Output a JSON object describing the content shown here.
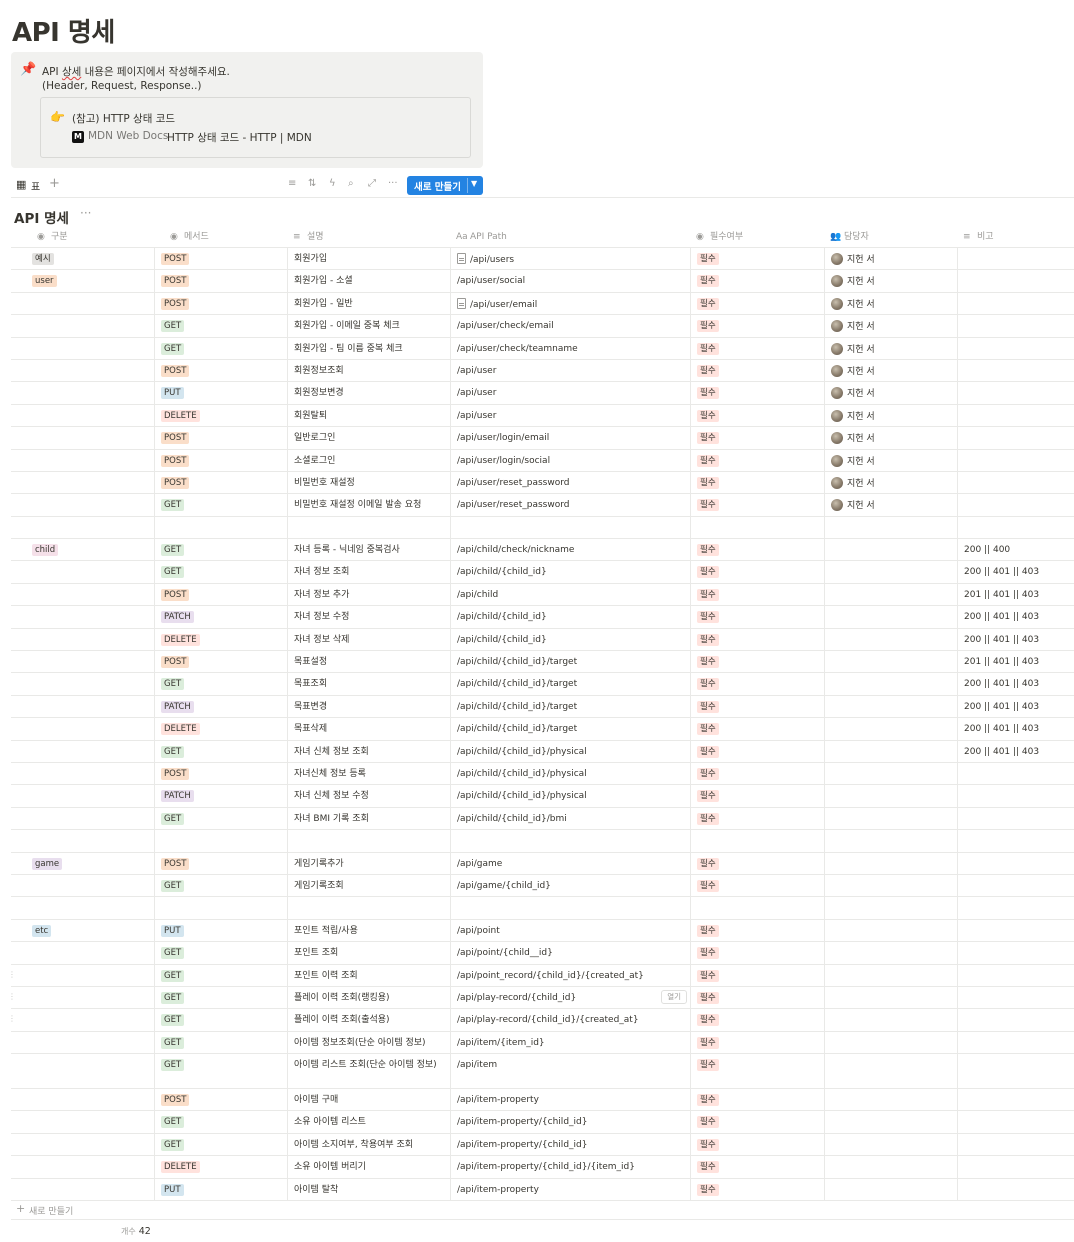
{
  "page": {
    "title": "API 명세"
  },
  "callout": {
    "icon": "pushpin-icon",
    "line1_pre": "API ",
    "line1_squiggle": "상세",
    "line1_post": " 내용은 페이지에서 작성해주세요.",
    "line2": "(Header, Request, Response..)",
    "ref_title": "(참고) HTTP 상태 코드",
    "ref_logo": "M",
    "ref_source": "MDN Web Docs",
    "ref_link": "HTTP 상태 코드 - HTTP | MDN"
  },
  "toolbar": {
    "view_label": "표",
    "add": "+",
    "new_label": "새로 만들기"
  },
  "database": {
    "title": "API 명세",
    "more": "···",
    "columns": {
      "group": "구분",
      "method": "메서드",
      "desc": "설명",
      "path": "API Path",
      "required": "필수여부",
      "owner": "담당자",
      "note": "비고"
    },
    "rows": [
      {
        "group": "예시",
        "method": "POST",
        "desc": "회원가입",
        "path": "/api/users",
        "doc": true,
        "req": "필수",
        "owner": "지헌 서",
        "note": ""
      },
      {
        "group": "user",
        "method": "POST",
        "desc": "회원가입 - 소셜",
        "path": "/api/user/social",
        "req": "필수",
        "owner": "지헌 서",
        "note": ""
      },
      {
        "group": "",
        "method": "POST",
        "desc": "회원가입 - 일반",
        "path": "/api/user/email",
        "doc": true,
        "req": "필수",
        "owner": "지헌 서",
        "note": ""
      },
      {
        "group": "",
        "method": "GET",
        "desc": "회원가입 - 이메일 중복 체크",
        "path": "/api/user/check/email",
        "req": "필수",
        "owner": "지헌 서",
        "note": ""
      },
      {
        "group": "",
        "method": "GET",
        "desc": "회원가입 - 팀 이름 중복 체크",
        "path": "/api/user/check/teamname",
        "req": "필수",
        "owner": "지헌 서",
        "note": ""
      },
      {
        "group": "",
        "method": "POST",
        "desc": "회원정보조회",
        "path": "/api/user",
        "req": "필수",
        "owner": "지헌 서",
        "note": ""
      },
      {
        "group": "",
        "method": "PUT",
        "desc": "회원정보변경",
        "path": "/api/user",
        "req": "필수",
        "owner": "지헌 서",
        "note": ""
      },
      {
        "group": "",
        "method": "DELETE",
        "desc": "회원탈퇴",
        "path": "/api/user",
        "req": "필수",
        "owner": "지헌 서",
        "note": ""
      },
      {
        "group": "",
        "method": "POST",
        "desc": "일반로그인",
        "path": "/api/user/login/email",
        "req": "필수",
        "owner": "지헌 서",
        "note": ""
      },
      {
        "group": "",
        "method": "POST",
        "desc": "소셜로그인",
        "path": "/api/user/login/social",
        "req": "필수",
        "owner": "지헌 서",
        "note": ""
      },
      {
        "group": "",
        "method": "POST",
        "desc": "비밀번호 재설정",
        "path": "/api/user/reset_password",
        "req": "필수",
        "owner": "지헌 서",
        "note": ""
      },
      {
        "group": "",
        "method": "GET",
        "desc": "비밀번호 재설정 이메일 발송 요청",
        "path": "/api/user/reset_password",
        "req": "필수",
        "owner": "지헌 서",
        "note": ""
      },
      {
        "group": "",
        "method": "",
        "desc": "",
        "path": "",
        "req": "",
        "owner": "",
        "note": ""
      },
      {
        "group": "child",
        "method": "GET",
        "desc": "자녀 등록 -  닉네임 중복검사",
        "path": "/api/child/check/nickname",
        "req": "필수",
        "owner": "",
        "note": "200 || 400"
      },
      {
        "group": "",
        "method": "GET",
        "desc": "자녀 정보 조회",
        "path": "/api/child/{child_id}",
        "req": "필수",
        "owner": "",
        "note": "200 || 401 || 403"
      },
      {
        "group": "",
        "method": "POST",
        "desc": "자녀 정보 추가",
        "path": "/api/child",
        "req": "필수",
        "owner": "",
        "note": "201 ||  401 || 403"
      },
      {
        "group": "",
        "method": "PATCH",
        "desc": "자녀 정보 수정",
        "path": "/api/child/{child_id}",
        "req": "필수",
        "owner": "",
        "note": "200 || 401 || 403"
      },
      {
        "group": "",
        "method": "DELETE",
        "desc": "자녀 정보 삭제",
        "path": "/api/child/{child_id}",
        "req": "필수",
        "owner": "",
        "note": "200 || 401 || 403"
      },
      {
        "group": "",
        "method": "POST",
        "desc": "목표설정",
        "path": "/api/child/{child_id}/target",
        "req": "필수",
        "owner": "",
        "note": "201 || 401 || 403"
      },
      {
        "group": "",
        "method": "GET",
        "desc": "목표조회",
        "path": "/api/child/{child_id}/target",
        "req": "필수",
        "owner": "",
        "note": "200 || 401 || 403"
      },
      {
        "group": "",
        "method": "PATCH",
        "desc": "목표변경",
        "path": "/api/child/{child_id}/target",
        "req": "필수",
        "owner": "",
        "note": "200 || 401 || 403"
      },
      {
        "group": "",
        "method": "DELETE",
        "desc": "목표삭제",
        "path": "/api/child/{child_id}/target",
        "req": "필수",
        "owner": "",
        "note": "200 || 401 || 403"
      },
      {
        "group": "",
        "method": "GET",
        "desc": "자녀 신체 정보 조회",
        "path": "/api/child/{child_id}/physical",
        "req": "필수",
        "owner": "",
        "note": "200 || 401 || 403"
      },
      {
        "group": "",
        "method": "POST",
        "desc": "자녀신체 정보 등록",
        "path": "/api/child/{child_id}/physical",
        "req": "필수",
        "owner": "",
        "note": ""
      },
      {
        "group": "",
        "method": "PATCH",
        "desc": "자녀 신체 정보 수정",
        "path": "/api/child/{child_id}/physical",
        "req": "필수",
        "owner": "",
        "note": ""
      },
      {
        "group": "",
        "method": "GET",
        "desc": "자녀 BMI 기록 조회",
        "path": "/api/child/{child_id}/bmi",
        "req": "필수",
        "owner": "",
        "note": ""
      },
      {
        "group": "",
        "method": "",
        "desc": "",
        "path": "",
        "req": "",
        "owner": "",
        "note": ""
      },
      {
        "group": "game",
        "method": "POST",
        "desc": "게임기록추가",
        "path": "/api/game",
        "req": "필수",
        "owner": "",
        "note": ""
      },
      {
        "group": "",
        "method": "GET",
        "desc": "게임기록조회",
        "path": "/api/game/{child_id}",
        "req": "필수",
        "owner": "",
        "note": ""
      },
      {
        "group": "",
        "method": "",
        "desc": "",
        "path": "",
        "req": "",
        "owner": "",
        "note": ""
      },
      {
        "group": "etc",
        "method": "PUT",
        "desc": "포인트 적립/사용",
        "path": "/api/point",
        "req": "필수",
        "owner": "",
        "note": ""
      },
      {
        "group": "",
        "method": "GET",
        "desc": "포인트 조회",
        "path": "/api/point/{child__id}",
        "req": "필수",
        "owner": "",
        "note": ""
      },
      {
        "group": "",
        "method": "GET",
        "desc": "포인트 이력 조회",
        "path": "/api/point_record/{child_id}/{created_at}",
        "req": "필수",
        "owner": "",
        "note": "",
        "handle": true
      },
      {
        "group": "",
        "method": "GET",
        "desc": "플레이 이력 조회(랭킹용)",
        "path": "/api/play-record/{child_id}",
        "req": "필수",
        "owner": "",
        "note": "",
        "handle": true,
        "open": "열기"
      },
      {
        "group": "",
        "method": "GET",
        "desc": "플레이 이력 조회(출석용)",
        "path": "/api/play-record/{child_id}/{created_at}",
        "req": "필수",
        "owner": "",
        "note": "",
        "handle": true
      },
      {
        "group": "",
        "method": "GET",
        "desc": "아이템 정보조회(단순 아이템 정보)",
        "path": "/api/item/{item_id}",
        "req": "필수",
        "owner": "",
        "note": ""
      },
      {
        "group": "",
        "method": "GET",
        "desc": "아이템 리스트 조회(단순 아이템 정보)",
        "path": "/api/item",
        "req": "필수",
        "owner": "",
        "note": "",
        "tall": true
      },
      {
        "group": "",
        "method": "POST",
        "desc": "아이템 구매",
        "path": "/api/item-property",
        "req": "필수",
        "owner": "",
        "note": ""
      },
      {
        "group": "",
        "method": "GET",
        "desc": "소유 아이템 리스트",
        "path": "/api/item-property/{child_id}",
        "req": "필수",
        "owner": "",
        "note": ""
      },
      {
        "group": "",
        "method": "GET",
        "desc": "아이템 소지여부, 착용여부 조회",
        "path": "/api/item-property/{child_id}",
        "req": "필수",
        "owner": "",
        "note": ""
      },
      {
        "group": "",
        "method": "DELETE",
        "desc": "소유 아이템 버리기",
        "path": "/api/item-property/{child_id}/{item_id}",
        "req": "필수",
        "owner": "",
        "note": ""
      },
      {
        "group": "",
        "method": "PUT",
        "desc": "아이템 탈착",
        "path": "/api/item-property",
        "req": "필수",
        "owner": "",
        "note": ""
      }
    ],
    "new_row_label": "새로 만들기",
    "count_label": "개수",
    "count_value": "42"
  },
  "colors": {
    "accent": "#2383e2",
    "tag_gray": "#e3e2e0",
    "tag_orange": "#fadec9",
    "tag_green": "#dbeddb",
    "tag_blue": "#d3e5ef",
    "tag_purple": "#e8deee",
    "tag_red": "#ffe2dd",
    "tag_pink": "#f5e0e9"
  }
}
